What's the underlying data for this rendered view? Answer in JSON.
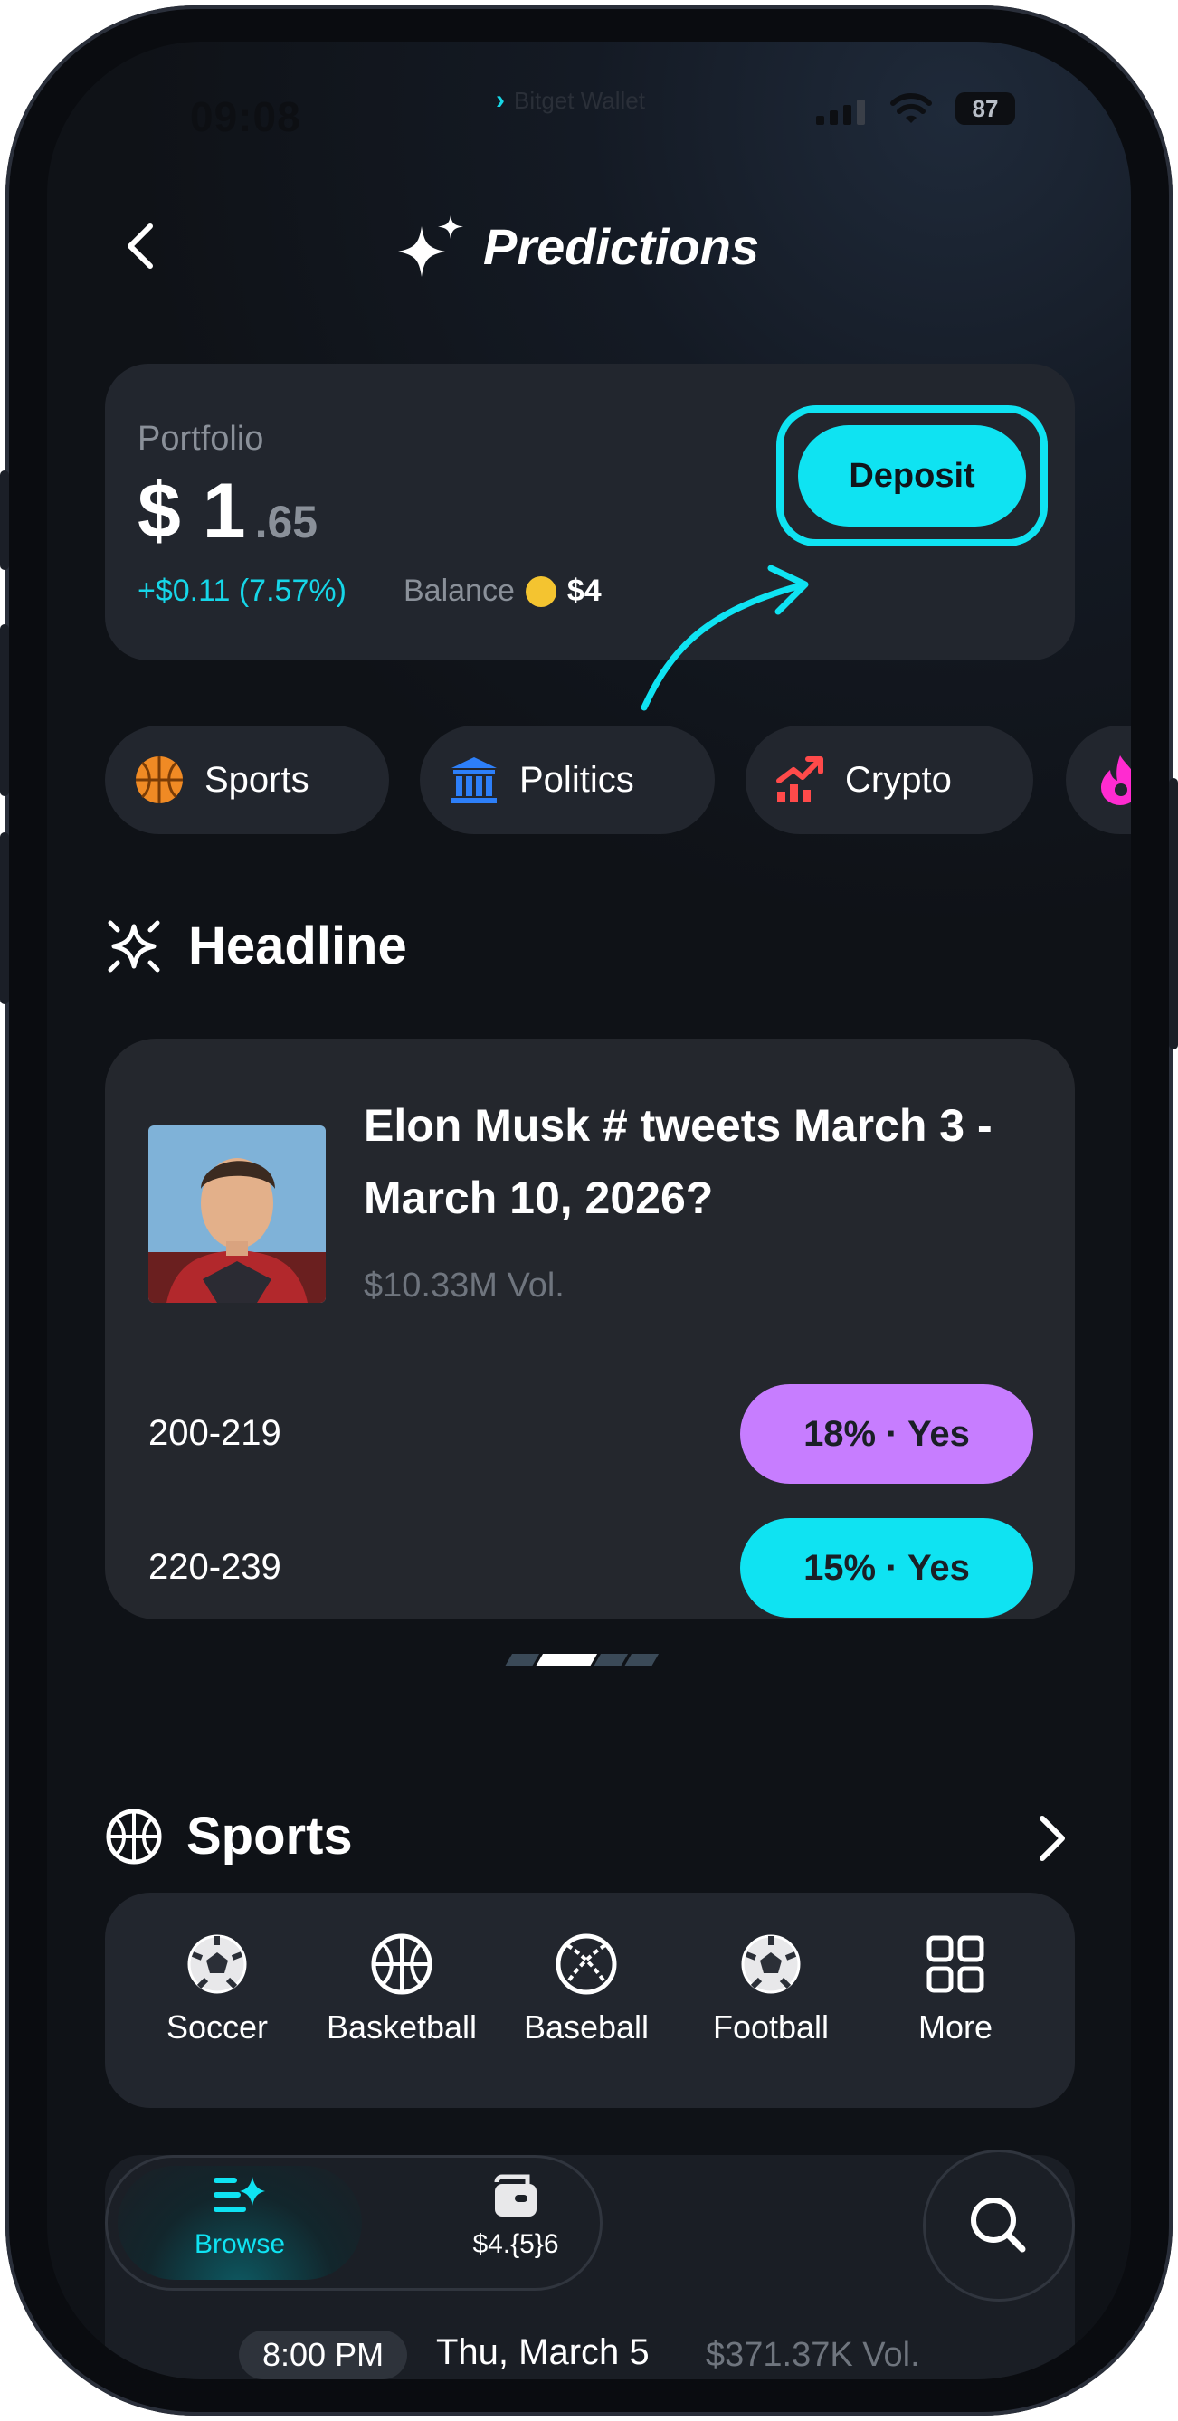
{
  "status_bar": {
    "time": "09:08",
    "app_badge": "Bitget Wallet",
    "battery": "87"
  },
  "header": {
    "title": "Predictions"
  },
  "portfolio": {
    "label": "Portfolio",
    "value_main": "$ 1",
    "value_decimal": ".65",
    "change": "+$0.11 (7.57%)",
    "balance_label": "Balance",
    "balance_amount": "$4",
    "deposit_label": "Deposit"
  },
  "categories": [
    {
      "label": "Sports",
      "icon": "basketball-icon",
      "color": "#f08a24"
    },
    {
      "label": "Politics",
      "icon": "bank-icon",
      "color": "#2d7ff9"
    },
    {
      "label": "Crypto",
      "icon": "trending-up-icon",
      "color": "#ff4a4a"
    }
  ],
  "headline": {
    "section_title": "Headline",
    "question": "Elon Musk # tweets March 3 - March 10, 2026?",
    "volume": "$10.33M Vol.",
    "outcomes": [
      {
        "range": "200-219",
        "button": "18% · Yes",
        "color": "#c77dff"
      },
      {
        "range": "220-239",
        "button": "15% · Yes",
        "color": "#0fe3f2"
      }
    ]
  },
  "sports": {
    "section_title": "Sports",
    "items": [
      {
        "label": "Soccer",
        "icon": "soccer-icon"
      },
      {
        "label": "Basketball",
        "icon": "basketball-icon"
      },
      {
        "label": "Baseball",
        "icon": "baseball-icon"
      },
      {
        "label": "Football",
        "icon": "football-icon"
      },
      {
        "label": "More",
        "icon": "grid-icon"
      }
    ]
  },
  "bottom_nav": {
    "browse_label": "Browse",
    "wallet_label": "$4.{5}6"
  },
  "next_event": {
    "time": "8:00 PM",
    "date": "Thu, March 5",
    "volume": "$371.37K Vol."
  }
}
